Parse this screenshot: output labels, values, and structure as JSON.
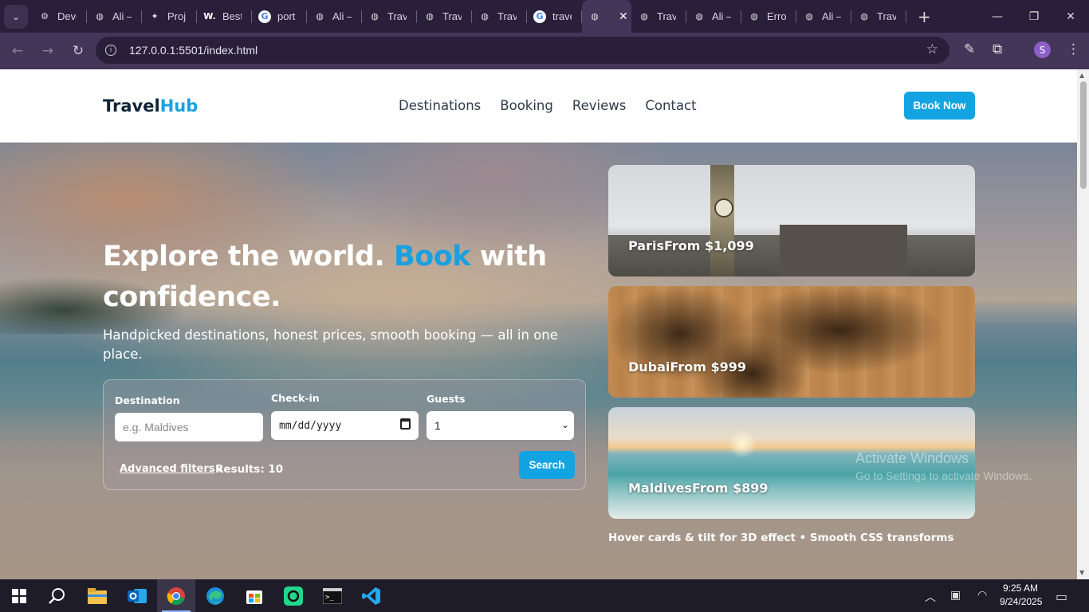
{
  "browser": {
    "tabs": [
      {
        "title": "Deve",
        "icon": "openai-icon"
      },
      {
        "title": "Ali –",
        "icon": "globe-icon"
      },
      {
        "title": "Proj",
        "icon": "pin-icon"
      },
      {
        "title": "Best",
        "icon": "w-icon"
      },
      {
        "title": "port",
        "icon": "google-icon"
      },
      {
        "title": "Ali –",
        "icon": "globe-icon"
      },
      {
        "title": "Trav",
        "icon": "globe-icon"
      },
      {
        "title": "Trav",
        "icon": "globe-icon"
      },
      {
        "title": "Trav",
        "icon": "globe-icon"
      },
      {
        "title": "trave",
        "icon": "google-icon"
      },
      {
        "title": "",
        "icon": "globe-icon",
        "active": true
      },
      {
        "title": "Trav",
        "icon": "globe-icon"
      },
      {
        "title": "Ali –",
        "icon": "globe-icon"
      },
      {
        "title": "Erro",
        "icon": "globe-icon"
      },
      {
        "title": "Ali –",
        "icon": "globe-icon"
      },
      {
        "title": "Trav",
        "icon": "globe-icon"
      }
    ],
    "url": "127.0.0.1:5501/index.html",
    "profile_initial": "S"
  },
  "site": {
    "logo_part1": "Travel",
    "logo_part2": "Hub",
    "nav": [
      "Destinations",
      "Booking",
      "Reviews",
      "Contact"
    ],
    "book_now": "Book Now",
    "headline_part1": "Explore the world. ",
    "headline_accent": "Book",
    "headline_part2": " with confidence.",
    "subline": "Handpicked destinations, honest prices, smooth booking — all in one place.",
    "search": {
      "destination_label": "Destination",
      "destination_placeholder": "e.g. Maldives",
      "checkin_label": "Check-in",
      "checkin_placeholder": "mm/dd/yyyy",
      "guests_label": "Guests",
      "guests_value": "1",
      "advanced_filters": "Advanced filters",
      "results": "Results: 10",
      "search_button": "Search"
    },
    "cards": [
      {
        "name": "Paris",
        "price": "From $1,099"
      },
      {
        "name": "Dubai",
        "price": "From $999"
      },
      {
        "name": "Maldives",
        "price": "From $899"
      }
    ],
    "hover_hint": "Hover cards & tilt for 3D effect • Smooth CSS transforms"
  },
  "watermark": {
    "line1": "Activate Windows",
    "line2": "Go to Settings to activate Windows."
  },
  "taskbar": {
    "time": "9:25 AM",
    "date": "9/24/2025",
    "apps": [
      "start-icon",
      "search-icon",
      "file-explorer-icon",
      "outlook-icon",
      "chrome-icon",
      "edge-icon",
      "store-icon",
      "pycharm-icon",
      "terminal-icon",
      "vscode-icon"
    ]
  }
}
